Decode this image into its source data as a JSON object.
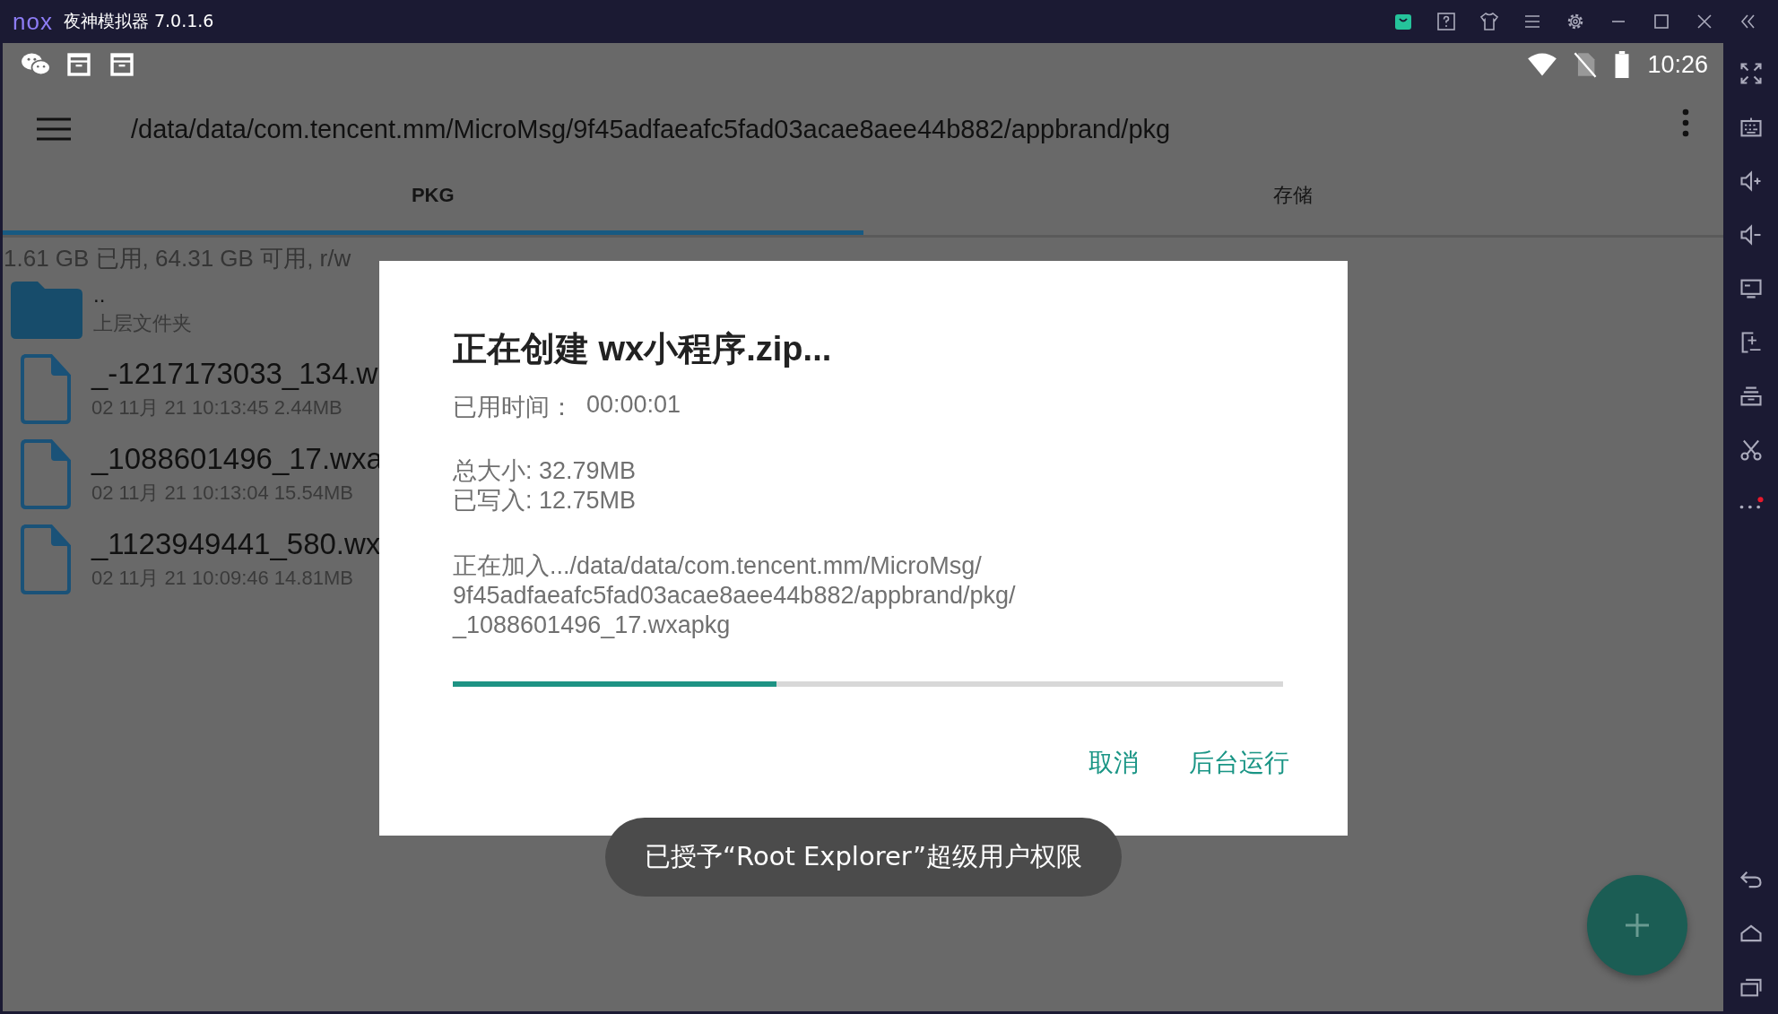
{
  "window": {
    "logo": "nox",
    "title": "夜神模拟器 7.0.1.6"
  },
  "status_bar": {
    "time": "10:26"
  },
  "toolbar": {
    "path": "/data/data/com.tencent.mm/MicroMsg/9f45adfaeafc5fad03acae8aee44b882/appbrand/pkg"
  },
  "tabs": [
    {
      "label": "PKG",
      "selected": true
    },
    {
      "label": "存储",
      "selected": false
    }
  ],
  "storage_info": "1.61 GB 已用, 64.31 GB 可用, r/w",
  "files": [
    {
      "kind": "folder",
      "name": "..",
      "detail": "上层文件夹"
    },
    {
      "kind": "file",
      "name": "_-1217173033_134.w",
      "detail": "02 11月 21 10:13:45  2.44MB"
    },
    {
      "kind": "file",
      "name": "_1088601496_17.wxa",
      "detail": "02 11月 21 10:13:04  15.54MB"
    },
    {
      "kind": "file",
      "name": "_1123949441_580.wx",
      "detail": "02 11月 21 10:09:46  14.81MB"
    }
  ],
  "dialog": {
    "title": "正在创建 wx小程序.zip...",
    "elapsed_label": "已用时间：",
    "elapsed": "00:00:01",
    "total": "总大小: 32.79MB",
    "written": "已写入: 12.75MB",
    "current": "正在加入.../data/data/com.tencent.mm/MicroMsg/\n9f45adfaeafc5fad03acae8aee44b882/appbrand/pkg/\n_1088601496_17.wxapkg",
    "level": 0.39,
    "buttons": [
      "取消",
      "后台运行"
    ]
  },
  "toast": "已授予“Root Explorer”超级用户权限"
}
